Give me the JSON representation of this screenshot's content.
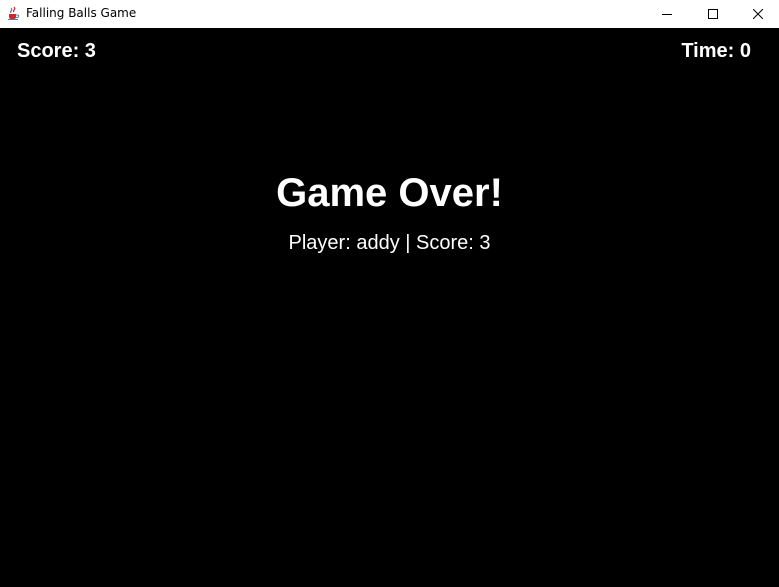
{
  "window": {
    "title": "Falling Balls Game",
    "app_icon": "java-cup-icon",
    "controls": {
      "minimize_icon": "minimize-icon",
      "maximize_icon": "maximize-icon",
      "close_icon": "close-icon"
    }
  },
  "hud": {
    "score_label": "Score: 3",
    "time_label": "Time: 0"
  },
  "game_over": {
    "title": "Game Over!",
    "summary": "Player: addy | Score: 3"
  },
  "colors": {
    "background": "#000000",
    "text": "#ffffff",
    "titlebar": "#ffffff"
  }
}
